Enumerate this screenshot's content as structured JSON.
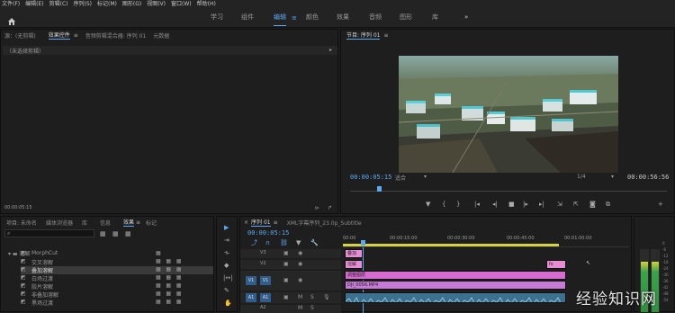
{
  "menu": [
    "文件(F)",
    "编辑(E)",
    "剪辑(C)",
    "序列(S)",
    "标记(M)",
    "图形(G)",
    "视图(V)",
    "窗口(W)",
    "帮助(H)"
  ],
  "workspaces": {
    "learn": "学习",
    "assembly": "组件",
    "editing": "编辑",
    "color": "颜色",
    "effects": "效果",
    "audio": "音频",
    "graphics": "图形",
    "library": "库"
  },
  "source_panel": {
    "tabs": {
      "source": "源：(无剪辑)",
      "effect_controls": "效果控件",
      "audio_mixer": "音频剪辑混合器: 序列 01",
      "metadata": "元数据"
    },
    "no_clip": "（未选择剪辑）",
    "timecode": "00:00:05:15"
  },
  "program": {
    "title": "节目: 序列 01",
    "timecode": "00:00:05:15",
    "fit": "适合",
    "resolution": "1/4",
    "duration": "00:00:56:56"
  },
  "project_panel": {
    "tabs": {
      "project": "项目: 未命名",
      "media_browser": "媒体浏览器",
      "library": "库",
      "info": "信息",
      "effects": "效果",
      "markers": "标记"
    },
    "folder": "溶解",
    "items": [
      "MorphCut",
      "交叉溶解",
      "叠加溶解",
      "白场过渡",
      "胶片溶解",
      "非叠加溶解",
      "黑场过渡"
    ]
  },
  "timeline": {
    "tabs": {
      "seq1": "序列 01",
      "seq2": "XML字幕序列_23.0p_Subtitle"
    },
    "timecode": "00:00:05:15",
    "ruler": [
      "00:00",
      "00:00:15:00",
      "00:00:30:00",
      "00:00:45:00",
      "00:01:00:00"
    ],
    "tracks": {
      "v3": "V3",
      "v2": "V2",
      "v1": "V1",
      "a1": "A1",
      "a2": "A2",
      "src_v1": "V1",
      "src_a1": "A1"
    },
    "clips": {
      "v3": "叠加",
      "v2": "溶解",
      "v2b": "fx",
      "v1_title": "调整图层",
      "v1_video": "DJI_0056.MP4"
    }
  },
  "audio_meter": [
    "0",
    "-6",
    "-12",
    "-18",
    "-24",
    "-30",
    "-36",
    "-42",
    "-48",
    "-54"
  ],
  "watermark": "经验知识网"
}
